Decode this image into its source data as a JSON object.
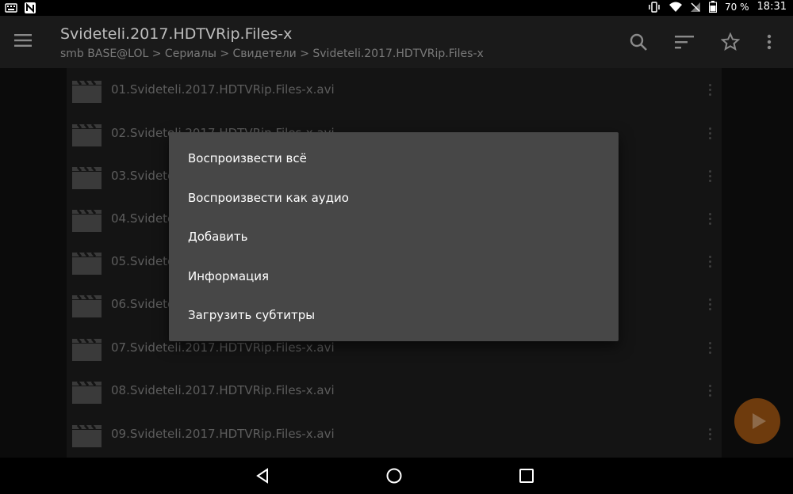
{
  "status": {
    "battery": "70 %",
    "time": "18:31"
  },
  "toolbar": {
    "title": "Svideteli.2017.HDTVRip.Files-x",
    "path": "smb BASE@LOL > Сериалы > Свидетели > Svideteli.2017.HDTVRip.Files-x"
  },
  "files": [
    {
      "name": "01.Svideteli.2017.HDTVRip.Files-x.avi"
    },
    {
      "name": "02.Svideteli.2017.HDTVRip.Files-x.avi"
    },
    {
      "name": "03.Svideteli.2017.HDTVRip.Files-x.avi"
    },
    {
      "name": "04.Svideteli.2017.HDTVRip.Files-x.avi"
    },
    {
      "name": "05.Svideteli.2017.HDTVRip.Files-x.avi"
    },
    {
      "name": "06.Svideteli.2017.HDTVRip.Files-x.avi"
    },
    {
      "name": "07.Svideteli.2017.HDTVRip.Files-x.avi"
    },
    {
      "name": "08.Svideteli.2017.HDTVRip.Files-x.avi"
    },
    {
      "name": "09.Svideteli.2017.HDTVRip.Files-x.avi"
    }
  ],
  "menu": {
    "items": [
      {
        "label": "Воспроизвести всё"
      },
      {
        "label": "Воспроизвести как аудио"
      },
      {
        "label": "Добавить"
      },
      {
        "label": "Информация"
      },
      {
        "label": "Загрузить субтитры"
      }
    ]
  },
  "colors": {
    "toolbar": "#1a1a1a",
    "popup": "#474747",
    "fab": "#6e3b0d"
  }
}
